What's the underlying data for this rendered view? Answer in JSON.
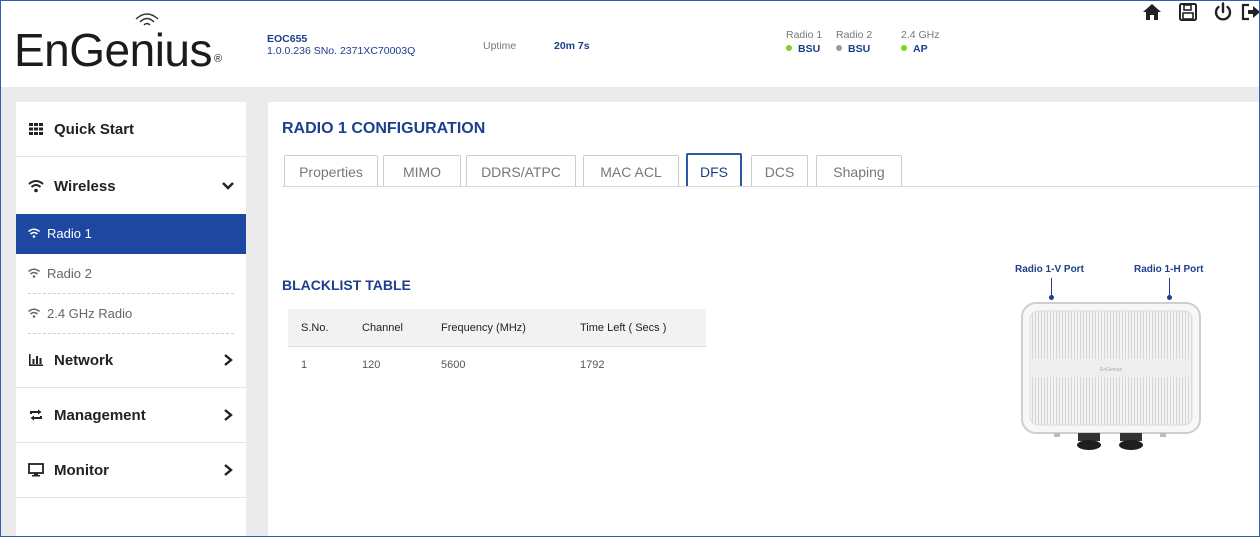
{
  "header": {
    "logo_text": "EnGenius",
    "logo_reg": "®",
    "model": "EOC655",
    "firmware_serial": "1.0.0.236 SNo. 2371XC70003Q",
    "uptime_label": "Uptime",
    "uptime_value": "20m 7s",
    "radios": [
      {
        "name": "Radio 1",
        "state": "BSU",
        "status_color": "#7ed321"
      },
      {
        "name": "Radio 2",
        "state": "BSU",
        "status_color": "#9b9b9b"
      },
      {
        "name": "2.4 GHz",
        "state": "AP",
        "status_color": "#7ed321"
      }
    ],
    "icons": [
      "home-icon",
      "save-icon",
      "power-icon",
      "logout-icon"
    ]
  },
  "sidebar": {
    "items": [
      {
        "label": "Quick Start",
        "icon": "grid-icon"
      },
      {
        "label": "Wireless",
        "icon": "wifi-icon",
        "expanded": true
      },
      {
        "label": "Network",
        "icon": "bar-chart-icon"
      },
      {
        "label": "Management",
        "icon": "refresh-icon"
      },
      {
        "label": "Monitor",
        "icon": "monitor-icon"
      }
    ],
    "sub_items": [
      {
        "label": "Radio 1",
        "active": true
      },
      {
        "label": "Radio 2",
        "active": false
      },
      {
        "label": "2.4 GHz Radio",
        "active": false
      }
    ]
  },
  "main": {
    "title": "RADIO 1 CONFIGURATION",
    "tabs": [
      "Properties",
      "MIMO",
      "DDRS/ATPC",
      "MAC ACL",
      "DFS",
      "DCS",
      "Shaping"
    ],
    "active_tab": "DFS",
    "section_title": "BLACKLIST TABLE",
    "table": {
      "columns": [
        "S.No.",
        "Channel",
        "Frequency (MHz)",
        "Time Left ( Secs )"
      ],
      "rows": [
        [
          "1",
          "120",
          "5600",
          "1792"
        ]
      ]
    },
    "device": {
      "port_v": "Radio 1-V Port",
      "port_h": "Radio 1-H Port",
      "brand": "EnGenius"
    }
  },
  "colors": {
    "brand_blue": "#1d3f8c",
    "active_bg": "#1d47a0",
    "status_on": "#7ed321",
    "status_off": "#9b9b9b"
  }
}
